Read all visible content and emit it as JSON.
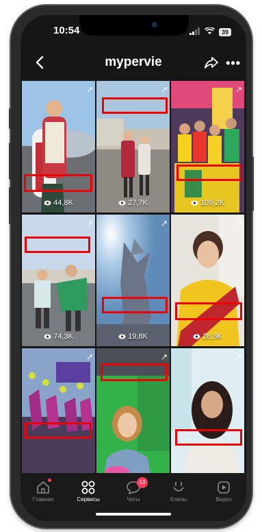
{
  "status_bar": {
    "time": "10:54",
    "battery": "39"
  },
  "header": {
    "title": "mypervie"
  },
  "videos": [
    {
      "views": "44,8K",
      "theme": "stadium"
    },
    {
      "views": "27,7K",
      "theme": "plaza"
    },
    {
      "views": "109,2K",
      "theme": "group"
    },
    {
      "views": "74,3K",
      "theme": "dance"
    },
    {
      "views": "19,8K",
      "theme": "sky"
    },
    {
      "views": "28,3K",
      "theme": "portrait"
    },
    {
      "views": "",
      "theme": "stage"
    },
    {
      "views": "",
      "theme": "green"
    },
    {
      "views": "",
      "theme": "girl"
    }
  ],
  "tabbar": {
    "items": [
      {
        "label": "Главная",
        "icon": "home-icon"
      },
      {
        "label": "Сервисы",
        "icon": "services-icon"
      },
      {
        "label": "Чаты",
        "icon": "chat-icon",
        "badge": "13"
      },
      {
        "label": "Клипы",
        "icon": "clips-icon"
      },
      {
        "label": "Видео",
        "icon": "video-icon"
      }
    ]
  },
  "colors": {
    "background": "#161616",
    "redaction": "#e00000",
    "badge": "#ff3b5c"
  }
}
